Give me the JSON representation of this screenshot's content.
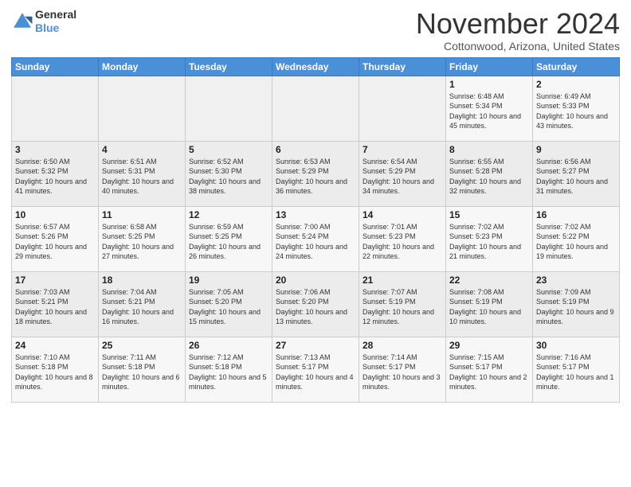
{
  "logo": {
    "line1": "General",
    "line2": "Blue"
  },
  "header": {
    "month": "November 2024",
    "location": "Cottonwood, Arizona, United States"
  },
  "days_of_week": [
    "Sunday",
    "Monday",
    "Tuesday",
    "Wednesday",
    "Thursday",
    "Friday",
    "Saturday"
  ],
  "weeks": [
    [
      {
        "day": "",
        "info": ""
      },
      {
        "day": "",
        "info": ""
      },
      {
        "day": "",
        "info": ""
      },
      {
        "day": "",
        "info": ""
      },
      {
        "day": "",
        "info": ""
      },
      {
        "day": "1",
        "info": "Sunrise: 6:48 AM\nSunset: 5:34 PM\nDaylight: 10 hours and 45 minutes."
      },
      {
        "day": "2",
        "info": "Sunrise: 6:49 AM\nSunset: 5:33 PM\nDaylight: 10 hours and 43 minutes."
      }
    ],
    [
      {
        "day": "3",
        "info": "Sunrise: 6:50 AM\nSunset: 5:32 PM\nDaylight: 10 hours and 41 minutes."
      },
      {
        "day": "4",
        "info": "Sunrise: 6:51 AM\nSunset: 5:31 PM\nDaylight: 10 hours and 40 minutes."
      },
      {
        "day": "5",
        "info": "Sunrise: 6:52 AM\nSunset: 5:30 PM\nDaylight: 10 hours and 38 minutes."
      },
      {
        "day": "6",
        "info": "Sunrise: 6:53 AM\nSunset: 5:29 PM\nDaylight: 10 hours and 36 minutes."
      },
      {
        "day": "7",
        "info": "Sunrise: 6:54 AM\nSunset: 5:29 PM\nDaylight: 10 hours and 34 minutes."
      },
      {
        "day": "8",
        "info": "Sunrise: 6:55 AM\nSunset: 5:28 PM\nDaylight: 10 hours and 32 minutes."
      },
      {
        "day": "9",
        "info": "Sunrise: 6:56 AM\nSunset: 5:27 PM\nDaylight: 10 hours and 31 minutes."
      }
    ],
    [
      {
        "day": "10",
        "info": "Sunrise: 6:57 AM\nSunset: 5:26 PM\nDaylight: 10 hours and 29 minutes."
      },
      {
        "day": "11",
        "info": "Sunrise: 6:58 AM\nSunset: 5:25 PM\nDaylight: 10 hours and 27 minutes."
      },
      {
        "day": "12",
        "info": "Sunrise: 6:59 AM\nSunset: 5:25 PM\nDaylight: 10 hours and 26 minutes."
      },
      {
        "day": "13",
        "info": "Sunrise: 7:00 AM\nSunset: 5:24 PM\nDaylight: 10 hours and 24 minutes."
      },
      {
        "day": "14",
        "info": "Sunrise: 7:01 AM\nSunset: 5:23 PM\nDaylight: 10 hours and 22 minutes."
      },
      {
        "day": "15",
        "info": "Sunrise: 7:02 AM\nSunset: 5:23 PM\nDaylight: 10 hours and 21 minutes."
      },
      {
        "day": "16",
        "info": "Sunrise: 7:02 AM\nSunset: 5:22 PM\nDaylight: 10 hours and 19 minutes."
      }
    ],
    [
      {
        "day": "17",
        "info": "Sunrise: 7:03 AM\nSunset: 5:21 PM\nDaylight: 10 hours and 18 minutes."
      },
      {
        "day": "18",
        "info": "Sunrise: 7:04 AM\nSunset: 5:21 PM\nDaylight: 10 hours and 16 minutes."
      },
      {
        "day": "19",
        "info": "Sunrise: 7:05 AM\nSunset: 5:20 PM\nDaylight: 10 hours and 15 minutes."
      },
      {
        "day": "20",
        "info": "Sunrise: 7:06 AM\nSunset: 5:20 PM\nDaylight: 10 hours and 13 minutes."
      },
      {
        "day": "21",
        "info": "Sunrise: 7:07 AM\nSunset: 5:19 PM\nDaylight: 10 hours and 12 minutes."
      },
      {
        "day": "22",
        "info": "Sunrise: 7:08 AM\nSunset: 5:19 PM\nDaylight: 10 hours and 10 minutes."
      },
      {
        "day": "23",
        "info": "Sunrise: 7:09 AM\nSunset: 5:19 PM\nDaylight: 10 hours and 9 minutes."
      }
    ],
    [
      {
        "day": "24",
        "info": "Sunrise: 7:10 AM\nSunset: 5:18 PM\nDaylight: 10 hours and 8 minutes."
      },
      {
        "day": "25",
        "info": "Sunrise: 7:11 AM\nSunset: 5:18 PM\nDaylight: 10 hours and 6 minutes."
      },
      {
        "day": "26",
        "info": "Sunrise: 7:12 AM\nSunset: 5:18 PM\nDaylight: 10 hours and 5 minutes."
      },
      {
        "day": "27",
        "info": "Sunrise: 7:13 AM\nSunset: 5:17 PM\nDaylight: 10 hours and 4 minutes."
      },
      {
        "day": "28",
        "info": "Sunrise: 7:14 AM\nSunset: 5:17 PM\nDaylight: 10 hours and 3 minutes."
      },
      {
        "day": "29",
        "info": "Sunrise: 7:15 AM\nSunset: 5:17 PM\nDaylight: 10 hours and 2 minutes."
      },
      {
        "day": "30",
        "info": "Sunrise: 7:16 AM\nSunset: 5:17 PM\nDaylight: 10 hours and 1 minute."
      }
    ]
  ]
}
